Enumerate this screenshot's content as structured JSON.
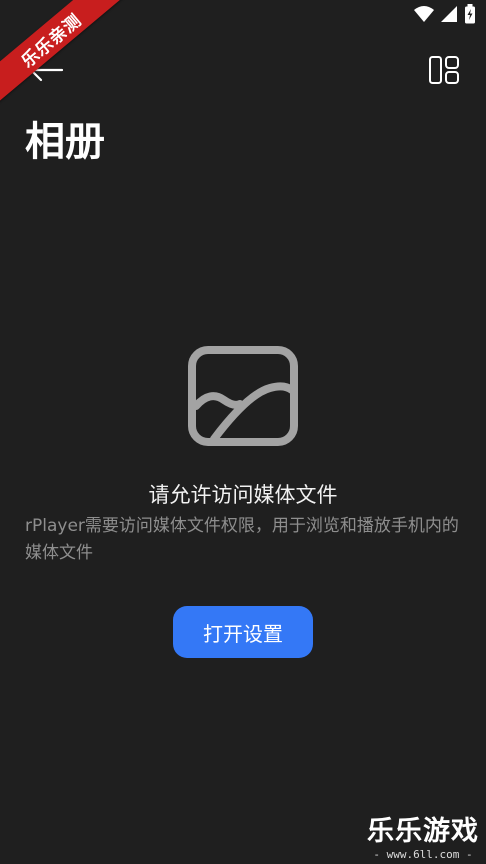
{
  "ribbon": {
    "label": "乐乐亲测"
  },
  "header": {
    "title": "相册"
  },
  "empty_state": {
    "title": "请允许访问媒体文件",
    "description": "rPlayer需要访问媒体文件权限，用于浏览和播放手机内的媒体文件",
    "button_label": "打开设置",
    "icon": "image-icon"
  },
  "watermark": {
    "title": "乐乐游戏",
    "url": "- www.6ll.com -"
  },
  "colors": {
    "background": "#1f1f1f",
    "accent": "#3478f6",
    "ribbon": "#c81e1e",
    "secondary_text": "#8e8e8e"
  }
}
